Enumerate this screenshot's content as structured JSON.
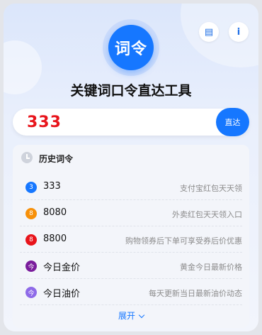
{
  "app": {
    "logo_text": "词令",
    "title": "关键词口令直达工具"
  },
  "header": {
    "book_icon_glyph": "▤",
    "info_icon_glyph": "i"
  },
  "search": {
    "value": "333",
    "placeholder": "",
    "go_label": "直达"
  },
  "history": {
    "title": "历史词令",
    "items": [
      {
        "badge": "3",
        "badge_color": "#1677ff",
        "code": "333",
        "desc": "支付宝红包天天领"
      },
      {
        "badge": "8",
        "badge_color": "#f79009",
        "code": "8080",
        "desc": "外卖红包天天领入口"
      },
      {
        "badge": "8",
        "badge_color": "#e8141b",
        "code": "8800",
        "desc": "购物领券后下单可享受券后价优惠"
      },
      {
        "badge": "今",
        "badge_color": "#7a1d9c",
        "code": "今日金价",
        "desc": "黄金今日最新价格"
      },
      {
        "badge": "今",
        "badge_color": "#8e6ae8",
        "code": "今日油价",
        "desc": "每天更新当日最新油价动态"
      }
    ],
    "expand_label": "展开"
  }
}
